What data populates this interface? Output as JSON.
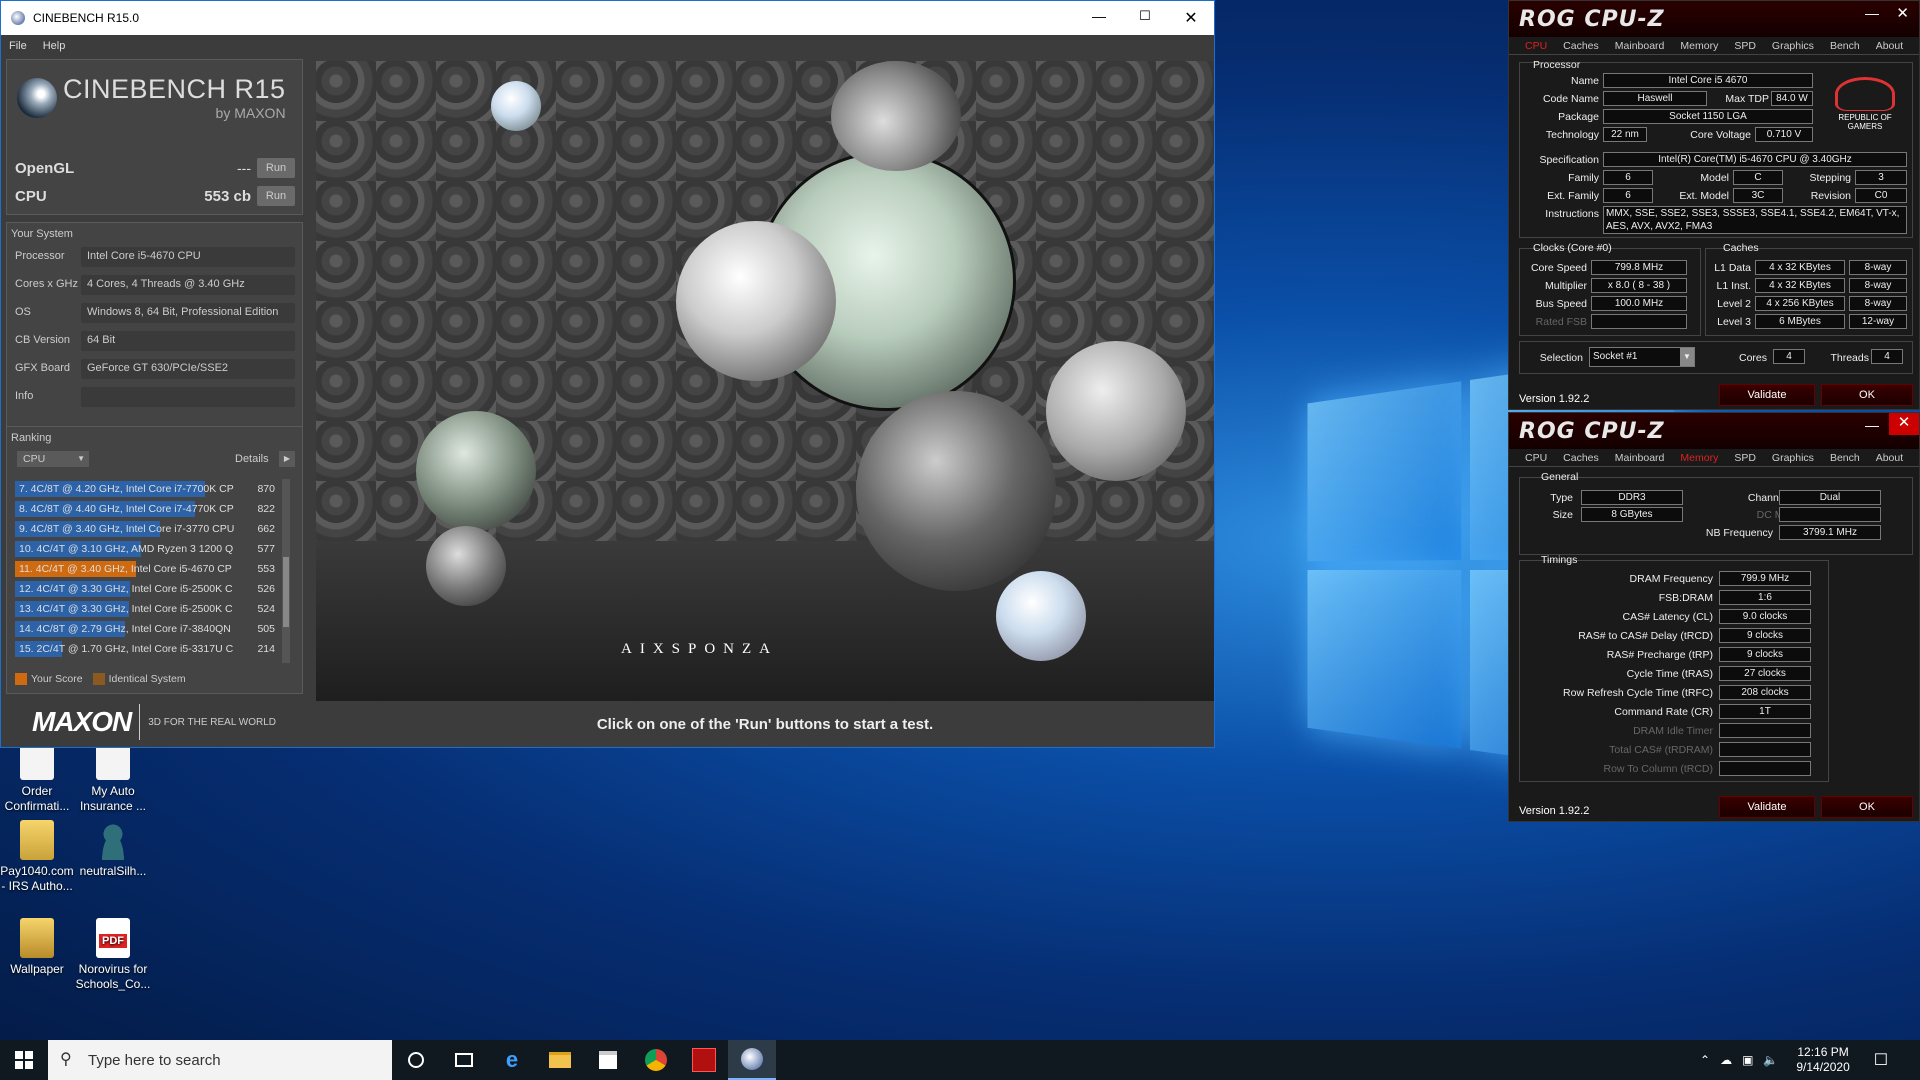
{
  "cinebench": {
    "title": "CINEBENCH R15.0",
    "menu": [
      "File",
      "Help"
    ],
    "logo_title": "CINEBENCH R15",
    "logo_sub": "by MAXON",
    "opengl_label": "OpenGL",
    "opengl_value": "---",
    "cpu_label": "CPU",
    "cpu_value": "553 cb",
    "run_label": "Run",
    "your_system": "Your System",
    "system": [
      {
        "label": "Processor",
        "value": "Intel Core i5-4670 CPU"
      },
      {
        "label": "Cores x GHz",
        "value": "4 Cores, 4 Threads @ 3.40 GHz"
      },
      {
        "label": "OS",
        "value": "Windows 8, 64 Bit, Professional Edition"
      },
      {
        "label": "CB Version",
        "value": "64 Bit"
      },
      {
        "label": "GFX Board",
        "value": "GeForce GT 630/PCIe/SSE2"
      },
      {
        "label": "Info",
        "value": ""
      }
    ],
    "ranking_title": "Ranking",
    "ranking_select": "CPU",
    "details_label": "Details",
    "ranking": [
      {
        "text": "7. 4C/8T @ 4.20 GHz, Intel Core i7-7700K CP",
        "score": "870",
        "fraction": 1.0,
        "highlight": false
      },
      {
        "text": "8. 4C/8T @ 4.40 GHz, Intel Core i7-4770K CP",
        "score": "822",
        "fraction": 0.945,
        "highlight": false
      },
      {
        "text": "9. 4C/8T @ 3.40 GHz,  Intel Core i7-3770 CPU",
        "score": "662",
        "fraction": 0.761,
        "highlight": false
      },
      {
        "text": "10. 4C/4T @ 3.10 GHz, AMD Ryzen 3 1200 Q",
        "score": "577",
        "fraction": 0.663,
        "highlight": false
      },
      {
        "text": "11. 4C/4T @ 3.40 GHz, Intel Core i5-4670 CP",
        "score": "553",
        "fraction": 0.636,
        "highlight": true
      },
      {
        "text": "12. 4C/4T @ 3.30 GHz,  Intel Core i5-2500K C",
        "score": "526",
        "fraction": 0.605,
        "highlight": false
      },
      {
        "text": "13. 4C/4T @ 3.30 GHz,  Intel Core i5-2500K C",
        "score": "524",
        "fraction": 0.602,
        "highlight": false
      },
      {
        "text": "14. 4C/8T @ 2.79 GHz,  Intel Core i7-3840QN",
        "score": "505",
        "fraction": 0.58,
        "highlight": false
      },
      {
        "text": "15. 2C/4T @ 1.70 GHz,  Intel Core i5-3317U C",
        "score": "214",
        "fraction": 0.246,
        "highlight": false
      }
    ],
    "legend_your_score": "Your Score",
    "legend_identical": "Identical System",
    "footer_brand": "MAXON",
    "footer_tagline": "3D FOR THE REAL WORLD",
    "render_watermark": "AIXSPONZA",
    "status_message": "Click on one of the 'Run' buttons to start a test."
  },
  "cpuz_top": {
    "logo": "ROG CPU-Z",
    "tabs": [
      "CPU",
      "Caches",
      "Mainboard",
      "Memory",
      "SPD",
      "Graphics",
      "Bench",
      "About"
    ],
    "active_tab": "CPU",
    "processor_title": "Processor",
    "name_label": "Name",
    "name": "Intel Core i5 4670",
    "codename_label": "Code Name",
    "codename": "Haswell",
    "maxtdp_label": "Max TDP",
    "maxtdp": "84.0 W",
    "package_label": "Package",
    "package": "Socket 1150 LGA",
    "technology_label": "Technology",
    "technology": "22 nm",
    "corevoltage_label": "Core Voltage",
    "corevoltage": "0.710 V",
    "rog_text": "REPUBLIC OF GAMERS",
    "spec_label": "Specification",
    "spec": "Intel(R) Core(TM) i5-4670 CPU @ 3.40GHz",
    "family_label": "Family",
    "family": "6",
    "model_label": "Model",
    "model": "C",
    "stepping_label": "Stepping",
    "stepping": "3",
    "extfamily_label": "Ext. Family",
    "extfamily": "6",
    "extmodel_label": "Ext. Model",
    "extmodel": "3C",
    "revision_label": "Revision",
    "revision": "C0",
    "instructions_label": "Instructions",
    "instructions": "MMX, SSE, SSE2, SSE3, SSSE3, SSE4.1, SSE4.2, EM64T, VT-x, AES, AVX, AVX2, FMA3",
    "clocks_title": "Clocks (Core #0)",
    "corespeed_label": "Core Speed",
    "corespeed": "799.8 MHz",
    "multiplier_label": "Multiplier",
    "multiplier": "x 8.0 ( 8 - 38 )",
    "busspeed_label": "Bus Speed",
    "busspeed": "100.0 MHz",
    "ratedfsb_label": "Rated FSB",
    "caches_title": "Caches",
    "l1d_label": "L1 Data",
    "l1d": "4 x 32 KBytes",
    "l1d_way": "8-way",
    "l1i_label": "L1 Inst.",
    "l1i": "4 x 32 KBytes",
    "l1i_way": "8-way",
    "l2_label": "Level 2",
    "l2": "4 x 256 KBytes",
    "l2_way": "8-way",
    "l3_label": "Level 3",
    "l3": "6 MBytes",
    "l3_way": "12-way",
    "selection_label": "Selection",
    "selection": "Socket #1",
    "cores_label": "Cores",
    "cores": "4",
    "threads_label": "Threads",
    "threads": "4",
    "version": "Version 1.92.2",
    "validate": "Validate",
    "ok": "OK"
  },
  "cpuz_bottom": {
    "logo": "ROG CPU-Z",
    "tabs": [
      "CPU",
      "Caches",
      "Mainboard",
      "Memory",
      "SPD",
      "Graphics",
      "Bench",
      "About"
    ],
    "active_tab": "Memory",
    "general_title": "General",
    "type_label": "Type",
    "type": "DDR3",
    "size_label": "Size",
    "size": "8 GBytes",
    "channels_label": "Channels #",
    "channels": "Dual",
    "dcmode_label": "DC Mode",
    "nbfreq_label": "NB Frequency",
    "nbfreq": "3799.1 MHz",
    "timings_title": "Timings",
    "timings": [
      {
        "label": "DRAM Frequency",
        "value": "799.9 MHz",
        "dim": false
      },
      {
        "label": "FSB:DRAM",
        "value": "1:6",
        "dim": false
      },
      {
        "label": "CAS# Latency (CL)",
        "value": "9.0 clocks",
        "dim": false
      },
      {
        "label": "RAS# to CAS# Delay (tRCD)",
        "value": "9 clocks",
        "dim": false
      },
      {
        "label": "RAS# Precharge (tRP)",
        "value": "9 clocks",
        "dim": false
      },
      {
        "label": "Cycle Time (tRAS)",
        "value": "27 clocks",
        "dim": false
      },
      {
        "label": "Row Refresh Cycle Time (tRFC)",
        "value": "208 clocks",
        "dim": false
      },
      {
        "label": "Command Rate (CR)",
        "value": "1T",
        "dim": false
      },
      {
        "label": "DRAM Idle Timer",
        "value": "",
        "dim": true
      },
      {
        "label": "Total CAS# (tRDRAM)",
        "value": "",
        "dim": true
      },
      {
        "label": "Row To Column (tRCD)",
        "value": "",
        "dim": true
      }
    ],
    "version": "Version 1.92.2",
    "validate": "Validate",
    "ok": "OK"
  },
  "desktop_icons": [
    {
      "label": "Order Confirmati...",
      "icon": "document-icon"
    },
    {
      "label": "My Auto Insurance ...",
      "icon": "document-icon"
    },
    {
      "label": "Pay1040.com - IRS Autho...",
      "icon": "folder-icon"
    },
    {
      "label": "neutralSilh...",
      "icon": "person-icon"
    },
    {
      "label": "Wallpaper",
      "icon": "folder-icon"
    },
    {
      "label": "Norovirus for Schools_Co...",
      "icon": "pdf-icon"
    }
  ],
  "pdf_badge": "PDF",
  "taskbar": {
    "search_placeholder": "Type here to search",
    "time": "12:16 PM",
    "date": "9/14/2020"
  },
  "colors": {
    "cinebench_accent": "#2c63a8",
    "highlight": "#d06a10",
    "rog_red": "#e02020"
  }
}
